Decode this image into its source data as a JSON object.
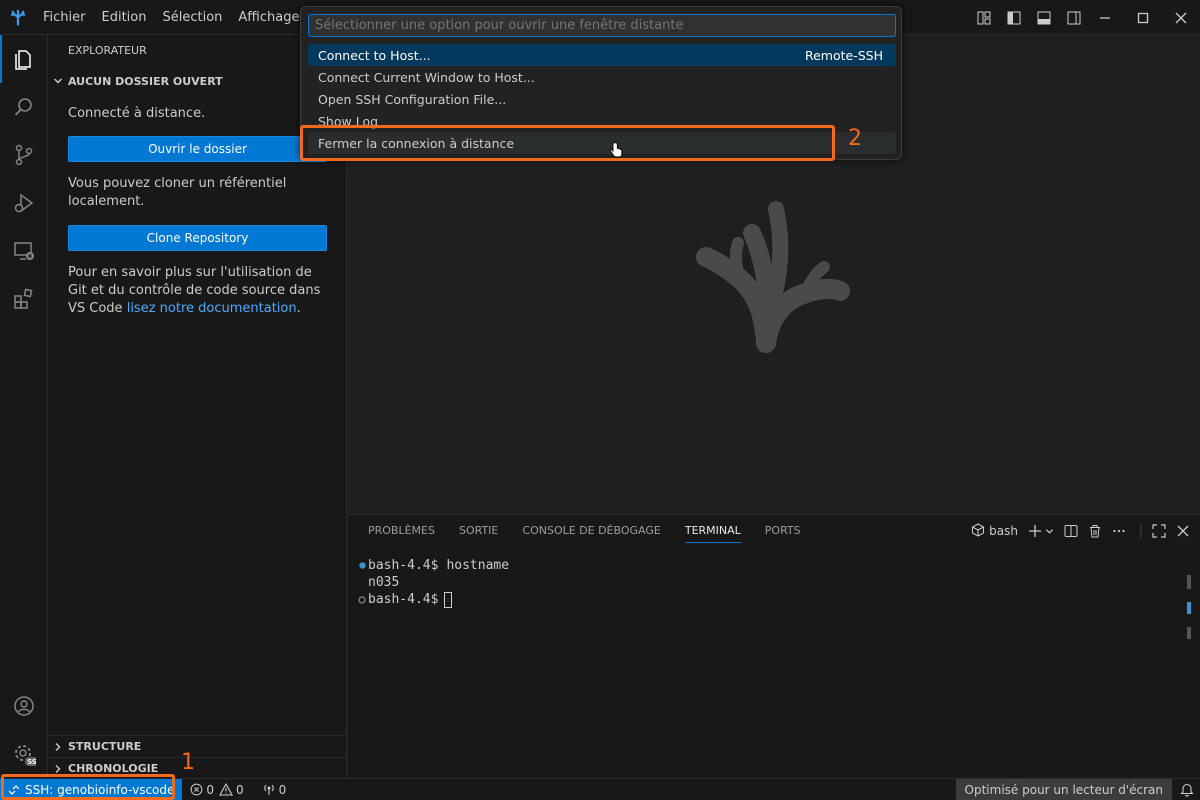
{
  "titlebar": {
    "menu": [
      "Fichier",
      "Edition",
      "Sélection",
      "Affichage"
    ]
  },
  "sidebar": {
    "header": "EXPLORATEUR",
    "section_title": "AUCUN DOSSIER OUVERT",
    "connected_text": "Connecté à distance.",
    "open_folder_button": "Ouvrir le dossier",
    "clone_text": "Vous pouvez cloner un référentiel localement.",
    "clone_button": "Clone Repository",
    "git_text": "Pour en savoir plus sur l'utilisation de Git et du contrôle de code source dans VS Code",
    "git_link": "lisez notre documentation",
    "git_text_end": ".",
    "structure": "STRUCTURE",
    "timeline": "CHRONOLOGIE"
  },
  "quickpick": {
    "placeholder": "Sélectionner une option pour ouvrir une fenêtre distante",
    "items": [
      {
        "label": "Connect to Host...",
        "description": "Remote-SSH"
      },
      {
        "label": "Connect Current Window to Host..."
      },
      {
        "label": "Open SSH Configuration File..."
      },
      {
        "label": "Show Log"
      },
      {
        "label": "Fermer la connexion à distance"
      }
    ]
  },
  "panel": {
    "tabs": [
      "PROBLÈMES",
      "SORTIE",
      "CONSOLE DE DÉBOGAGE",
      "TERMINAL",
      "PORTS"
    ],
    "active_tab": "TERMINAL",
    "terminal_name": "bash",
    "lines": [
      {
        "prompt": "bash-4.4$",
        "command": "hostname"
      },
      {
        "output": "n035"
      },
      {
        "prompt": "bash-4.4$",
        "command": ""
      }
    ]
  },
  "statusbar": {
    "remote": "SSH: genobioinfo-vscode",
    "errors": "0",
    "warnings": "0",
    "ports": "0",
    "screen_reader": "Optimisé pour un lecteur d'écran"
  },
  "annotations": {
    "one": "1",
    "two": "2"
  },
  "colors": {
    "accent": "#0078d4",
    "annotation": "#f26a1b",
    "selection": "#04395e"
  }
}
